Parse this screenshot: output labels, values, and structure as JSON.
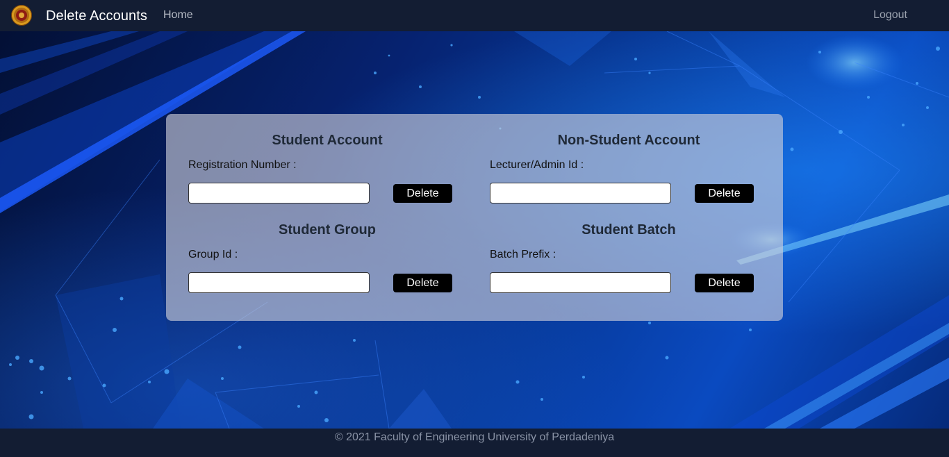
{
  "navbar": {
    "title": "Delete Accounts",
    "home_label": "Home",
    "logout_label": "Logout"
  },
  "sections": {
    "student_account": {
      "title": "Student Account",
      "field_label": "Registration Number :",
      "input_value": "",
      "button_label": "Delete"
    },
    "non_student_account": {
      "title": "Non-Student Account",
      "field_label": "Lecturer/Admin Id :",
      "input_value": "",
      "button_label": "Delete"
    },
    "student_group": {
      "title": "Student Group",
      "field_label": "Group Id :",
      "input_value": "",
      "button_label": "Delete"
    },
    "student_batch": {
      "title": "Student Batch",
      "field_label": "Batch Prefix :",
      "input_value": "",
      "button_label": "Delete"
    }
  },
  "footer": {
    "text": "© 2021 Faculty of Engineering University of Perdadeniya"
  },
  "colors": {
    "navbar_bg": "#131d33",
    "button_bg": "#000000",
    "card_bg": "rgba(210,210,220,0.62)"
  }
}
